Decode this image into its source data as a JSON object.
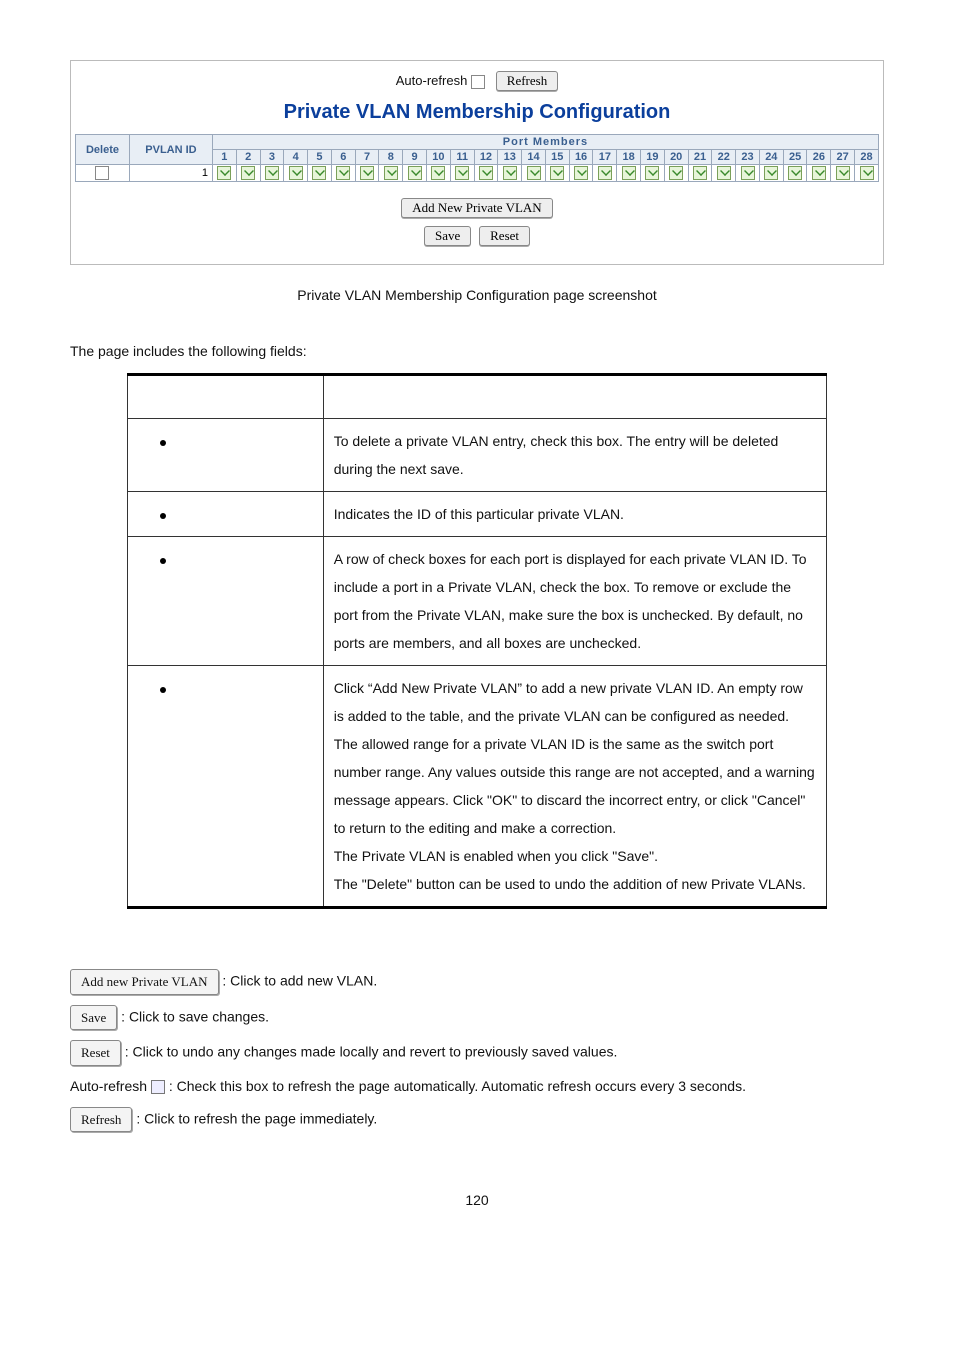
{
  "panel": {
    "autoRefreshLabel": "Auto-refresh",
    "refresh": "Refresh",
    "title": "Private VLAN Membership Configuration",
    "cols": {
      "delete": "Delete",
      "pvlan": "PVLAN ID",
      "members": "Port Members"
    },
    "ports": [
      "1",
      "2",
      "3",
      "4",
      "5",
      "6",
      "7",
      "8",
      "9",
      "10",
      "11",
      "12",
      "13",
      "14",
      "15",
      "16",
      "17",
      "18",
      "19",
      "20",
      "21",
      "22",
      "23",
      "24",
      "25",
      "26",
      "27",
      "28"
    ],
    "row": {
      "id": "1"
    },
    "addBtn": "Add New Private VLAN",
    "saveBtn": "Save",
    "resetBtn": "Reset"
  },
  "caption": "Private VLAN Membership Configuration page screenshot",
  "lead": "The page includes the following fields:",
  "fields": [
    {
      "desc": "To delete a private VLAN entry, check this box. The entry will be deleted during the next save."
    },
    {
      "desc": "Indicates the ID of this particular private VLAN."
    },
    {
      "desc": "A row of check boxes for each port is displayed for each private VLAN ID. To include a port in a Private VLAN, check the box. To remove or exclude the port from the Private VLAN, make sure the box is unchecked. By default, no ports are members, and all boxes are unchecked."
    },
    {
      "desc": "Click “Add New Private VLAN” to add a new private VLAN ID. An empty row is added to the table, and the private VLAN can be configured as needed. The allowed range for a private VLAN ID is the same as the switch port number range. Any values outside this range are not accepted, and a warning message appears. Click \"OK\" to discard the incorrect entry, or click \"Cancel\" to return to the editing and make a correction.\nThe Private VLAN is enabled when you click \"Save\".\nThe \"Delete\" button can be used to undo the addition of new Private VLANs."
    }
  ],
  "footer": {
    "addBtn": "Add new Private VLAN",
    "addTxt": ": Click to add new VLAN.",
    "saveBtn": "Save",
    "saveTxt": ": Click to save changes.",
    "resetBtn": "Reset",
    "resetTxt": ": Click to undo any changes made locally and revert to previously saved values.",
    "autoPrefix": "Auto-refresh ",
    "autoTxt": ": Check this box to refresh the page automatically. Automatic refresh occurs every 3 seconds.",
    "refreshBtn": "Refresh",
    "refreshTxt": ": Click to refresh the page immediately."
  },
  "pageNumber": "120"
}
